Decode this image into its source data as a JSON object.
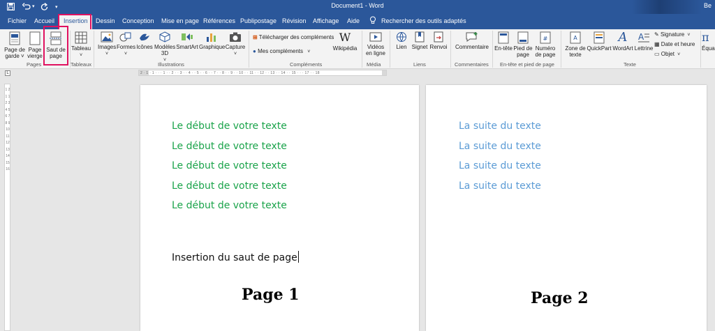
{
  "titlebar": {
    "document_title": "Document1  -  Word",
    "user_partial": "Be",
    "qa_customize": "▾"
  },
  "tabs": [
    {
      "label": "Fichier"
    },
    {
      "label": "Accueil"
    },
    {
      "label": "Insertion"
    },
    {
      "label": "Dessin"
    },
    {
      "label": "Conception"
    },
    {
      "label": "Mise en page"
    },
    {
      "label": "Références"
    },
    {
      "label": "Publipostage"
    },
    {
      "label": "Révision"
    },
    {
      "label": "Affichage"
    },
    {
      "label": "Aide"
    }
  ],
  "search": {
    "label": "Rechercher des outils adaptés"
  },
  "ribbon": {
    "pages": {
      "page_de_garde": "Page de garde ˅",
      "page_vierge": "Page vierge",
      "saut_de_page": "Saut de page",
      "group": "Pages"
    },
    "tableaux": {
      "tableau": "Tableau",
      "group": "Tableaux"
    },
    "illustrations": {
      "images": "Images",
      "formes": "Formes",
      "icones": "Icônes",
      "modeles3d": "Modèles 3D",
      "smartart": "SmartArt",
      "graphique": "Graphique",
      "capture": "Capture",
      "group": "Illustrations"
    },
    "complements": {
      "telecharger": "Télécharger des compléments",
      "mes": "Mes compléments",
      "wikipedia": "Wikipédia",
      "group": "Compléments"
    },
    "media": {
      "videos": "Vidéos en ligne",
      "group": "Média"
    },
    "liens": {
      "lien": "Lien",
      "signet": "Signet",
      "renvoi": "Renvoi",
      "group": "Liens"
    },
    "commentaires": {
      "commentaire": "Commentaire",
      "group": "Commentaires"
    },
    "entete": {
      "entete": "En-tête",
      "pied": "Pied de page",
      "numero": "Numéro de page",
      "group": "En-tête et pied de page"
    },
    "texte": {
      "zone": "Zone de texte",
      "quickpart": "QuickPart",
      "wordart": "WordArt",
      "lettrine": "Lettrine",
      "signature": "Signature",
      "date": "Date et heure",
      "objet": "Objet",
      "group": "Texte"
    },
    "equation_partial": "Équa"
  },
  "ruler": {
    "tab_selector": "L",
    "scale": "2 · 1 · 1 · · · 1 · · 2 · · 3 · · 4 · · 5 · · 6 · · 7 · · 8 · · 9 · · 10 · · 11 · · 12 · · 13 · · 14 · · 15 · · · 17 · · 18",
    "vscale": "1 2 1 1 2 3 4 5 6 7 8 9 10 11 12 13 14 15 16"
  },
  "page1": {
    "lines": [
      "Le début de votre texte",
      "Le début de votre texte",
      "Le début de votre texte",
      "Le début de votre texte",
      "Le début de votre texte"
    ],
    "insertion_text": "Insertion du saut de page",
    "caption": "Page 1"
  },
  "page2": {
    "lines": [
      "La suite du texte",
      "La suite du texte",
      "La suite du texte",
      "La suite du texte"
    ],
    "caption": "Page 2"
  },
  "colors": {
    "brand": "#2b579a",
    "highlight": "#e0115f",
    "green_text": "#1aa34a",
    "blue_text": "#5b9bd5"
  }
}
